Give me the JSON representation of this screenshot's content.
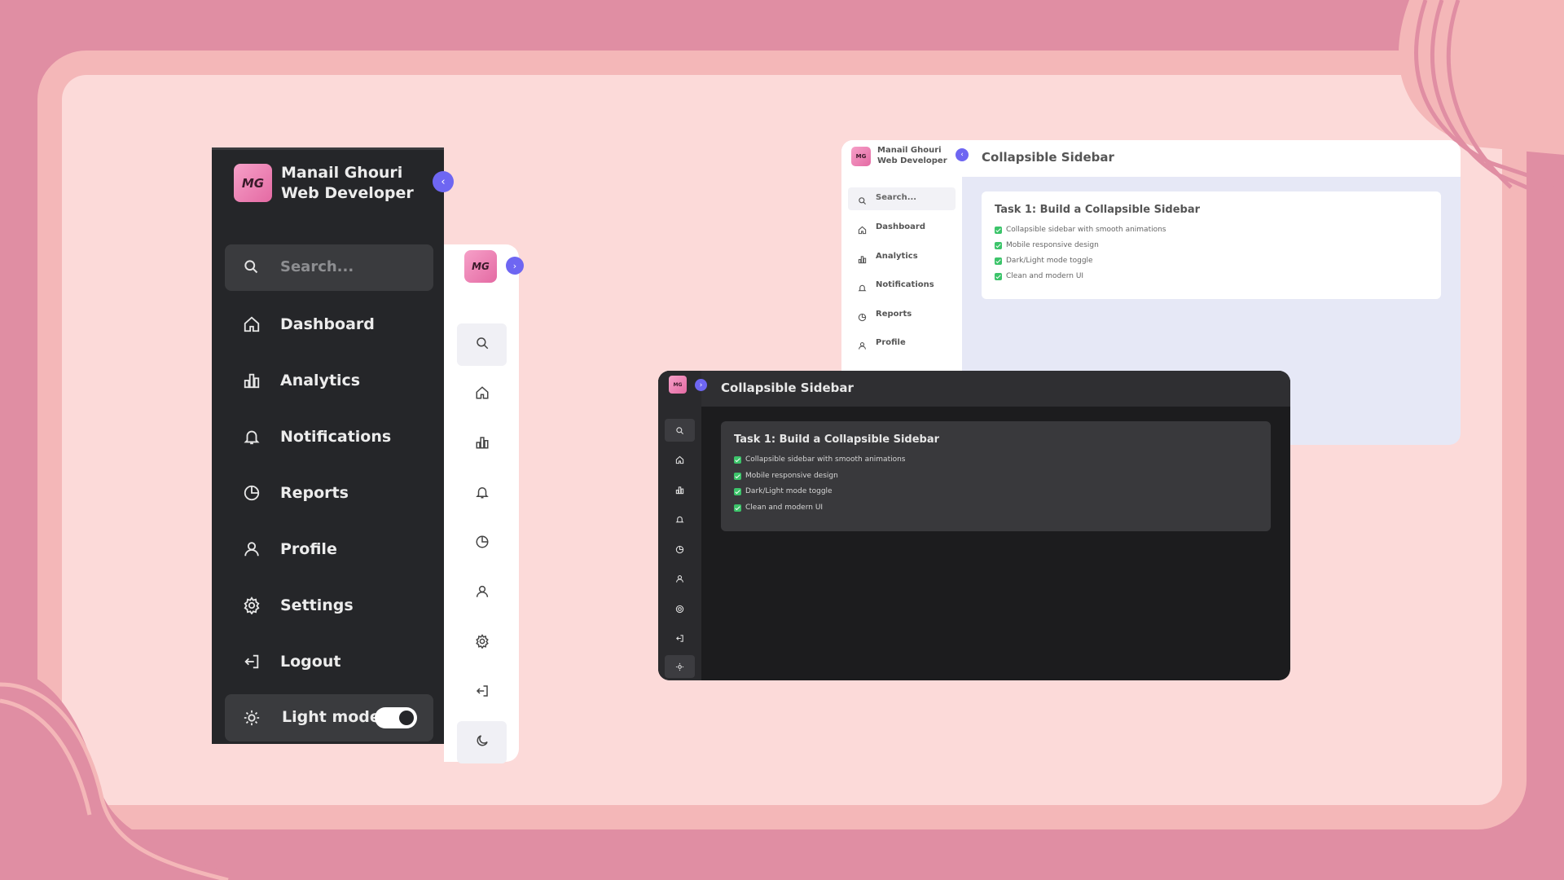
{
  "user": {
    "name": "Manail Ghouri",
    "role": "Web Developer",
    "avatar_text": "MG"
  },
  "search": {
    "placeholder": "Search..."
  },
  "nav": [
    {
      "label": "Dashboard",
      "icon": "home-icon"
    },
    {
      "label": "Analytics",
      "icon": "bar-chart-icon"
    },
    {
      "label": "Notifications",
      "icon": "bell-icon"
    },
    {
      "label": "Reports",
      "icon": "pie-chart-icon"
    },
    {
      "label": "Profile",
      "icon": "user-icon"
    },
    {
      "label": "Settings",
      "icon": "gear-icon"
    },
    {
      "label": "Logout",
      "icon": "logout-icon"
    }
  ],
  "mode": {
    "label": "Light mode",
    "icon": "sun-icon",
    "toggle_on": true
  },
  "collapse_icons": {
    "collapse": "‹",
    "expand": "›"
  },
  "app": {
    "title": "Collapsible Sidebar",
    "task_title": "Task 1: Build a Collapsible Sidebar",
    "tasks": [
      "Collapsible sidebar with smooth animations",
      "Mobile responsive design",
      "Dark/Light mode toggle",
      "Clean and modern UI"
    ]
  },
  "colors": {
    "accent": "#6e66f2",
    "background": "#e08ea3",
    "frame": "#fcdad9",
    "dark_sidebar": "#252629",
    "check": "#3cc46a"
  }
}
